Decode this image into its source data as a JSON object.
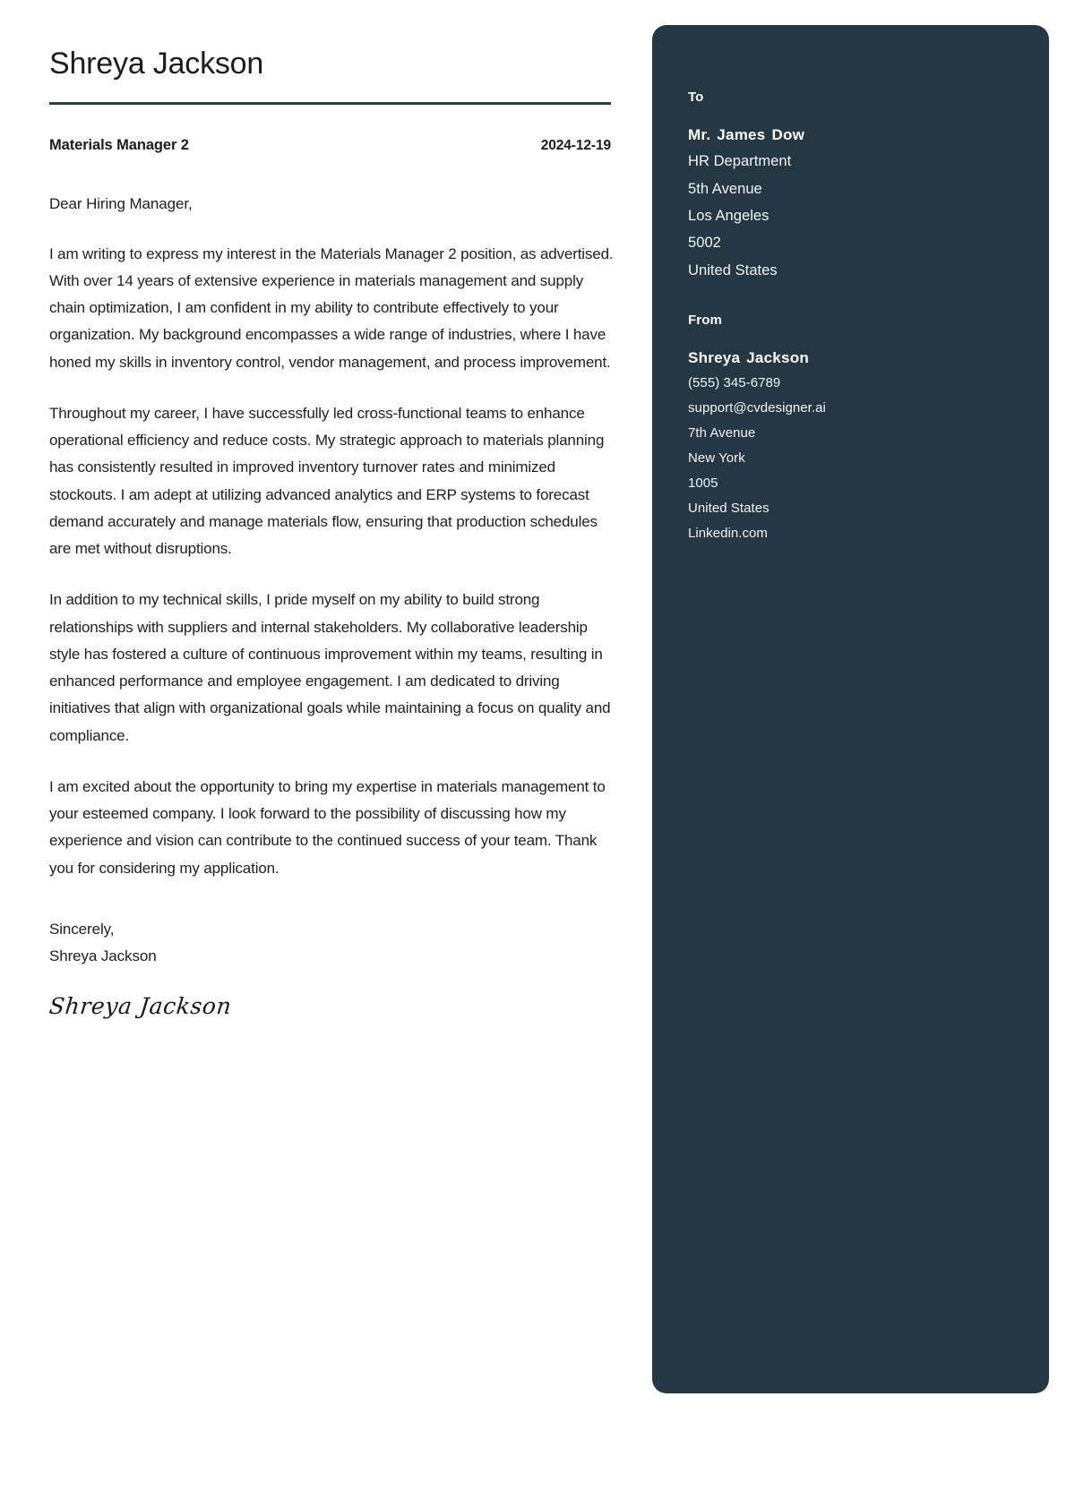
{
  "document": {
    "type": "cover-letter",
    "accent_color": "#243743",
    "page_background": "#ffffff",
    "text_color": "#1f1f1f"
  },
  "letter": {
    "applicant_name": "Shreya Jackson",
    "job_title": "Materials Manager 2",
    "date": "2024-12-19",
    "salutation": "Dear Hiring Manager,",
    "paragraphs": [
      "I am writing to express my interest in the Materials Manager 2 position, as advertised. With over 14 years of extensive experience in materials management and supply chain optimization, I am confident in my ability to contribute effectively to your organization. My background encompasses a wide range of industries, where I have honed my skills in inventory control, vendor management, and process improvement.",
      "Throughout my career, I have successfully led cross-functional teams to enhance operational efficiency and reduce costs. My strategic approach to materials planning has consistently resulted in improved inventory turnover rates and minimized stockouts. I am adept at utilizing advanced analytics and ERP systems to forecast demand accurately and manage materials flow, ensuring that production schedules are met without disruptions.",
      "In addition to my technical skills, I pride myself on my ability to build strong relationships with suppliers and internal stakeholders. My collaborative leadership style has fostered a culture of continuous improvement within my teams, resulting in enhanced performance and employee engagement. I am dedicated to driving initiatives that align with organizational goals while maintaining a focus on quality and compliance.",
      "I am excited about the opportunity to bring my expertise in materials management to your esteemed company. I look forward to the possibility of discussing how my experience and vision can contribute to the continued success of your team. Thank you for considering my application."
    ],
    "closing_word": "Sincerely,",
    "closing_name": "Shreya Jackson",
    "signature_script": "Shreya Jackson"
  },
  "sidebar": {
    "to": {
      "heading": "To",
      "name": "Mr. James Dow",
      "lines": [
        "HR Department",
        "5th Avenue",
        "Los Angeles",
        "5002",
        "United States"
      ]
    },
    "from": {
      "heading": "From",
      "name": "Shreya Jackson",
      "lines": [
        "(555) 345-6789",
        "support@cvdesigner.ai",
        "7th Avenue",
        "New York",
        "1005",
        "United States",
        "Linkedin.com"
      ]
    }
  }
}
